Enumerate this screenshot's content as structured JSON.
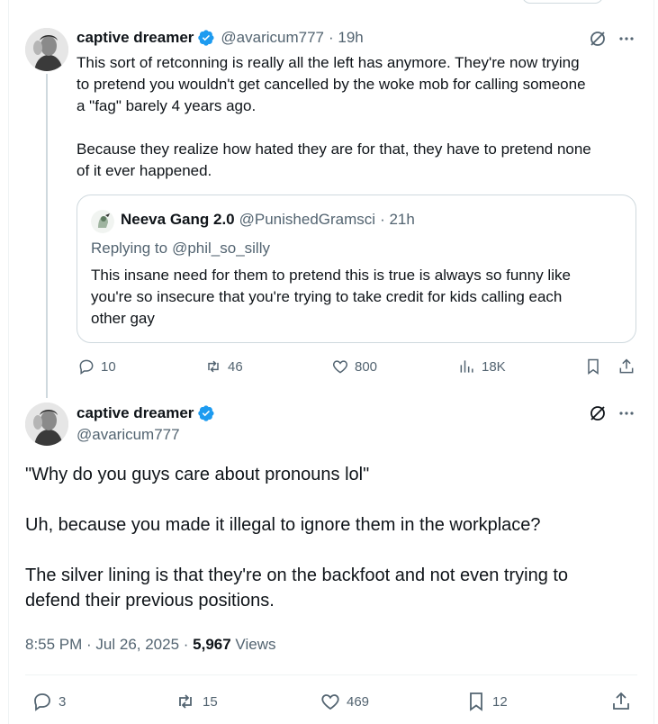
{
  "tweet1": {
    "author_name": "captive dreamer",
    "handle": "@avaricum777",
    "time": "· 19h",
    "text_lines_p1": [
      "This sort of retconning is really all the left has anymore.  They're now trying",
      "to pretend you wouldn't get cancelled by the woke mob for calling someone",
      "a \"fag\" barely 4 years ago."
    ],
    "text_lines_p2": [
      "Because they realize how hated they are for that, they have to pretend none",
      "of it ever happened."
    ],
    "quote": {
      "author_name": "Neeva Gang 2.0",
      "handle": "@PunishedGramsci",
      "time": "· 21h",
      "replying_prefix": "Replying to",
      "replying_handle": "@phil_so_silly",
      "text_lines": [
        "This insane need for them to pretend this is true is always so funny like",
        "you're so insecure that you're trying to take credit for kids calling each",
        "other gay"
      ]
    },
    "actions": {
      "replies": "10",
      "reposts": "46",
      "likes": "800",
      "views": "18K"
    }
  },
  "tweet2": {
    "author_name": "captive dreamer",
    "handle": "@avaricum777",
    "paragraphs": [
      "\"Why do you guys care about pronouns lol\"",
      "Uh, because you made it illegal to ignore them in the workplace?",
      "The silver lining is that they're on the backfoot and not even trying to",
      "defend their previous positions."
    ],
    "timestamp": "8:55 PM · Jul 26, 2025 · ",
    "view_count": "5,967",
    "views_label": " Views",
    "actions": {
      "replies": "3",
      "reposts": "15",
      "likes": "469",
      "bookmarks": "12"
    }
  },
  "colors": {
    "accent": "#1d9bf0",
    "text": "#0f1419",
    "muted": "#536471",
    "border": "#cfd9de"
  },
  "icons": [
    "verified-badge-icon",
    "grok-icon",
    "more-icon",
    "reply-icon",
    "repost-icon",
    "like-icon",
    "views-icon",
    "bookmark-icon",
    "share-icon"
  ]
}
